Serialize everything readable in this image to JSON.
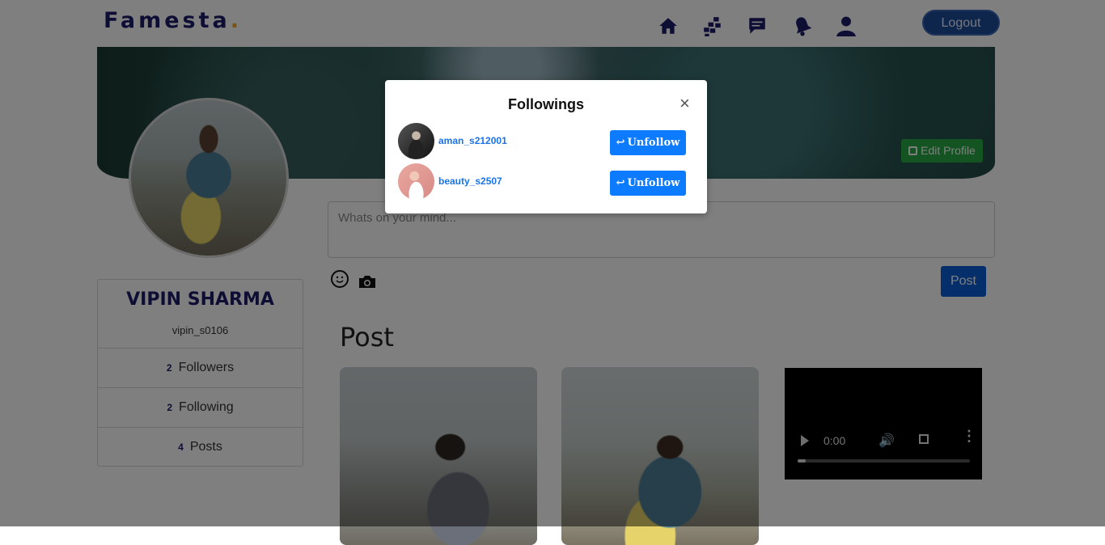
{
  "navbar": {
    "brand": "Famesta",
    "brand_dot": ".",
    "icons": [
      "home-icon",
      "grid-icon",
      "chat-icon",
      "bell-icon",
      "user-icon"
    ],
    "logout_label": "Logout"
  },
  "profile": {
    "edit_label": "Edit Profile",
    "name": "VIPIN SHARMA",
    "username": "vipin_s0106",
    "stats": [
      {
        "count": "2",
        "label": "Followers"
      },
      {
        "count": "2",
        "label": "Following"
      },
      {
        "count": "4",
        "label": "Posts"
      }
    ]
  },
  "composer": {
    "placeholder": "Whats on your mind...",
    "post_label": "Post"
  },
  "posts": {
    "heading": "Post",
    "video_time": "0:00"
  },
  "modal": {
    "title": "Followings",
    "close": "×",
    "items": [
      {
        "username": "aman_s212001",
        "action": "Unfollow"
      },
      {
        "username": "beauty_s2507",
        "action": "Unfollow"
      }
    ]
  },
  "colors": {
    "brand": "#1c1c6b",
    "accent_dot": "#f5a623",
    "primary": "#0d7bff",
    "success": "#28a745"
  }
}
